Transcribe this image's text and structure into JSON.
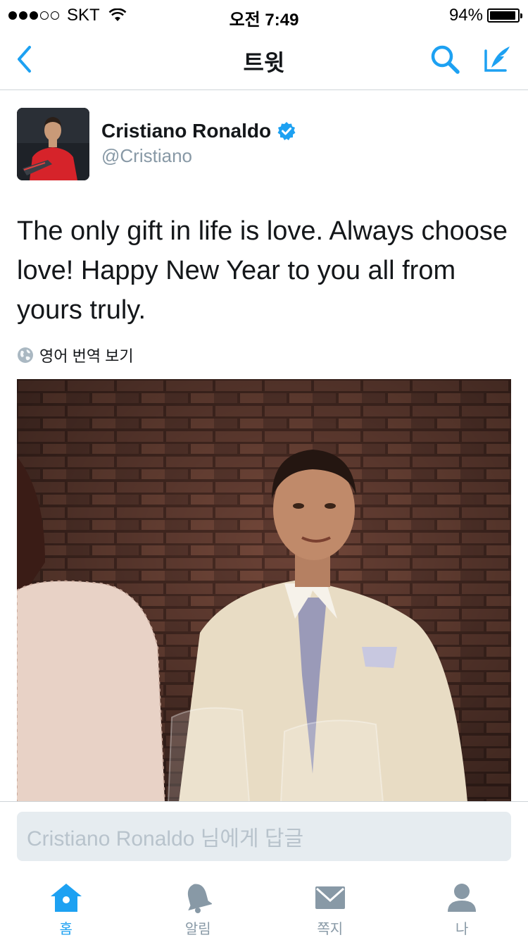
{
  "status_bar": {
    "carrier": "SKT",
    "time": "오전 7:49",
    "battery": "94%",
    "battery_level": 0.94,
    "signal_bars": 3
  },
  "nav": {
    "title": "트윗",
    "icons": [
      "chevron-left-icon",
      "search-icon",
      "compose-icon"
    ]
  },
  "tweet": {
    "user_name": "Cristiano Ronaldo",
    "handle": "@Cristiano",
    "verified": true,
    "text": "The only gift in life is love. Always choose love! Happy New Year to you all from yours truly.",
    "translate_label": "영어 번역 보기"
  },
  "reply": {
    "placeholder": "Cristiano Ronaldo 님에게 답글"
  },
  "tabs": [
    {
      "label": "홈",
      "icon": "home-icon",
      "active": true
    },
    {
      "label": "알림",
      "icon": "bell-icon",
      "active": false
    },
    {
      "label": "쪽지",
      "icon": "mail-icon",
      "active": false
    },
    {
      "label": "나",
      "icon": "person-icon",
      "active": false
    }
  ],
  "colors": {
    "accent": "#1da1f2",
    "text": "#14171a",
    "muted": "#8899a6",
    "reply_bg": "#e6ecf0"
  }
}
